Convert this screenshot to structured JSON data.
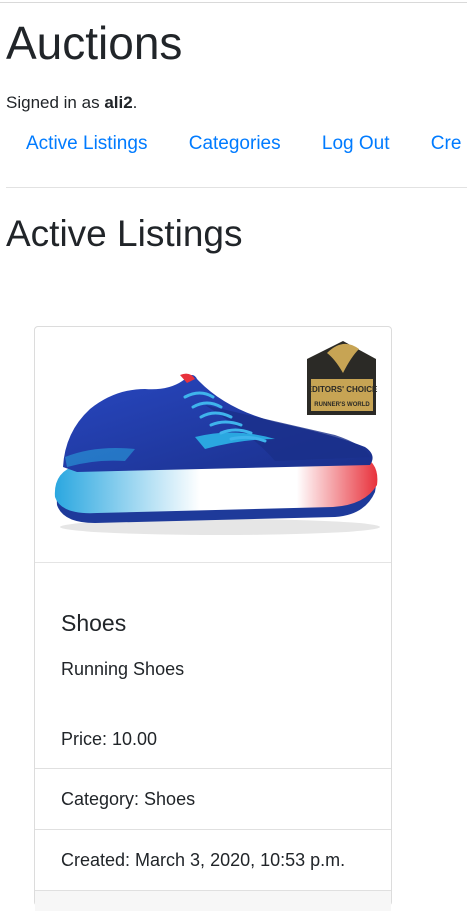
{
  "header": {
    "title": "Auctions",
    "signed_in_prefix": "Signed in as",
    "username": "ali2",
    "signed_in_suffix": "."
  },
  "nav": {
    "items": [
      {
        "label": "Active Listings"
      },
      {
        "label": "Categories"
      },
      {
        "label": "Log Out"
      },
      {
        "label": "Cre"
      }
    ]
  },
  "main": {
    "heading": "Active Listings"
  },
  "listing": {
    "image_alt": "Shoes",
    "title": "Shoes",
    "description": "Running Shoes",
    "price": "Price: 10.00",
    "category": "Category: Shoes",
    "created": "Created: March 3, 2020, 10:53 p.m.",
    "badge_lines": [
      "EDITORS' CHOICE",
      "RUNNER'S WORLD"
    ],
    "colors": {
      "upper": "#1f3fae",
      "accent": "#2aa7e0",
      "heel": "#e8323c"
    }
  }
}
